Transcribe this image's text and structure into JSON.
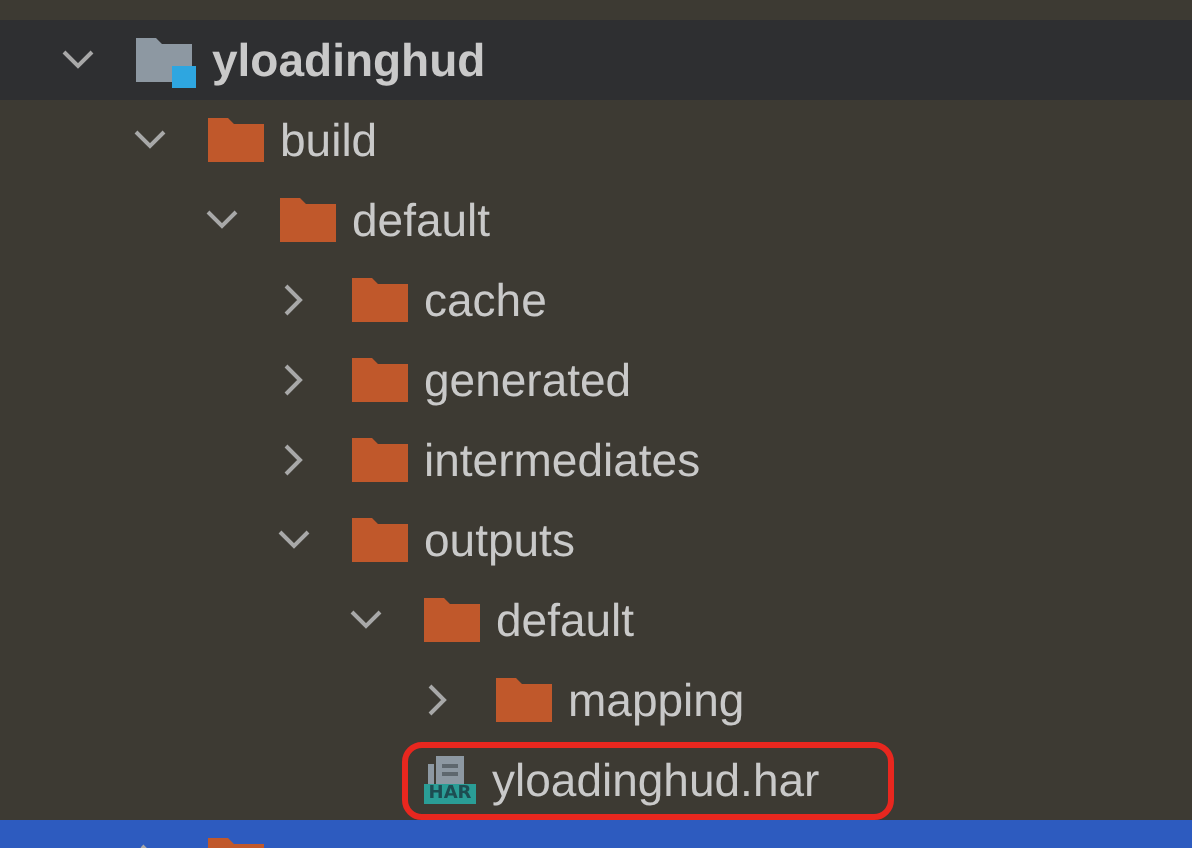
{
  "tree": [
    {
      "kind": "module",
      "label": "yloadinghud",
      "expanded": true,
      "selected": false,
      "outlined": false,
      "children": [
        {
          "kind": "folder",
          "label": "build",
          "expanded": true,
          "selected": false,
          "outlined": false,
          "children": [
            {
              "kind": "folder",
              "label": "default",
              "expanded": true,
              "selected": false,
              "outlined": false,
              "children": [
                {
                  "kind": "folder",
                  "label": "cache",
                  "expanded": false,
                  "selected": false,
                  "outlined": false
                },
                {
                  "kind": "folder",
                  "label": "generated",
                  "expanded": false,
                  "selected": false,
                  "outlined": false
                },
                {
                  "kind": "folder",
                  "label": "intermediates",
                  "expanded": false,
                  "selected": false,
                  "outlined": false
                },
                {
                  "kind": "folder",
                  "label": "outputs",
                  "expanded": true,
                  "selected": false,
                  "outlined": false,
                  "children": [
                    {
                      "kind": "folder",
                      "label": "default",
                      "expanded": true,
                      "selected": false,
                      "outlined": false,
                      "children": [
                        {
                          "kind": "folder",
                          "label": "mapping",
                          "expanded": false,
                          "selected": false,
                          "outlined": false
                        },
                        {
                          "kind": "har",
                          "label": "yloadinghud.har",
                          "badge": "HAR",
                          "selected": false,
                          "outlined": true
                        }
                      ]
                    }
                  ]
                }
              ]
            }
          ]
        },
        {
          "kind": "folder",
          "expanded": false,
          "selected": true,
          "outlined": false
        }
      ]
    }
  ]
}
